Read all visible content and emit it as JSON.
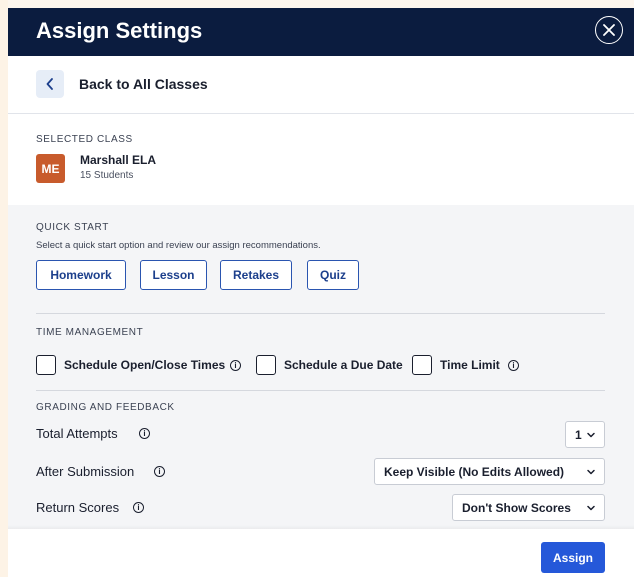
{
  "header": {
    "title": "Assign Settings",
    "close_icon": "close-circle-icon"
  },
  "nav": {
    "back_label": "Back to All Classes",
    "back_icon": "chevron-left-icon"
  },
  "selected_class": {
    "section_label": "SELECTED CLASS",
    "avatar_initials": "ME",
    "avatar_color": "#c85b2c",
    "name": "Marshall ELA",
    "count": "15 Students"
  },
  "quick_start": {
    "section_label": "QUICK START",
    "description": "Select a quick start option and review our assign recommendations.",
    "options": [
      "Homework",
      "Lesson",
      "Retakes",
      "Quiz"
    ]
  },
  "time_management": {
    "section_label": "TIME MANAGEMENT",
    "options": [
      {
        "label": "Schedule Open/Close Times",
        "checked": false,
        "info": true
      },
      {
        "label": "Schedule a Due Date",
        "checked": false,
        "info": false
      },
      {
        "label": "Time Limit",
        "checked": false,
        "info": true
      }
    ]
  },
  "grading": {
    "section_label": "GRADING AND FEEDBACK",
    "rows": [
      {
        "label": "Total Attempts",
        "value": "1"
      },
      {
        "label": "After Submission",
        "value": "Keep Visible (No Edits Allowed)"
      },
      {
        "label": "Return Scores",
        "value": "Don't Show Scores"
      }
    ]
  },
  "footer": {
    "assign_label": "Assign"
  },
  "colors": {
    "header_bg": "#0b1c3f",
    "accent": "#2558d9",
    "button_border": "#2a55b0"
  }
}
